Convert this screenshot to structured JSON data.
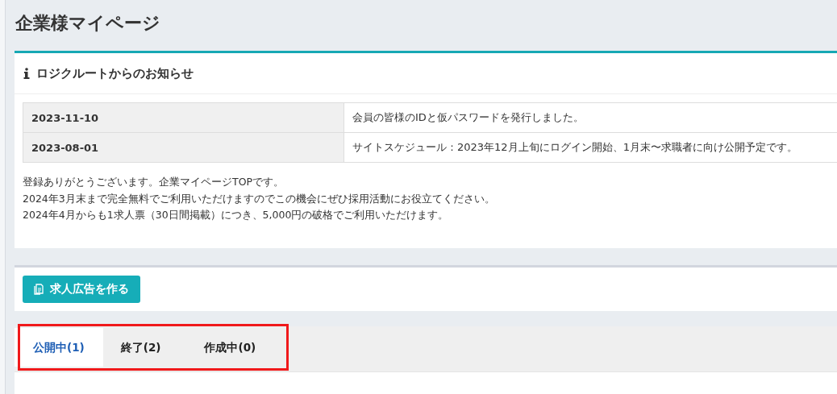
{
  "page_title": "企業様マイページ",
  "notice": {
    "title": "ロジクルートからのお知らせ",
    "rows": [
      {
        "date": "2023-11-10",
        "message": "会員の皆様のIDと仮パスワードを発行しました。"
      },
      {
        "date": "2023-08-01",
        "message": "サイトスケジュール：2023年12月上旬にログイン開始、1月末〜求職者に向け公開予定です。"
      }
    ],
    "lines": [
      "登録ありがとうございます。企業マイページTOPです。",
      "2024年3月末まで完全無料でご利用いただけますのでこの機会にぜひ採用活動にお役立てください。",
      "2024年4月からも1求人票（30日間掲載）につき、5,000円の破格でご利用いただけます。"
    ]
  },
  "create_button": {
    "label": "求人広告を作る"
  },
  "tabs": [
    {
      "label": "公開中(1)",
      "selected": true
    },
    {
      "label": "終了(2)",
      "selected": false
    },
    {
      "label": "作成中(0)",
      "selected": false
    }
  ]
}
